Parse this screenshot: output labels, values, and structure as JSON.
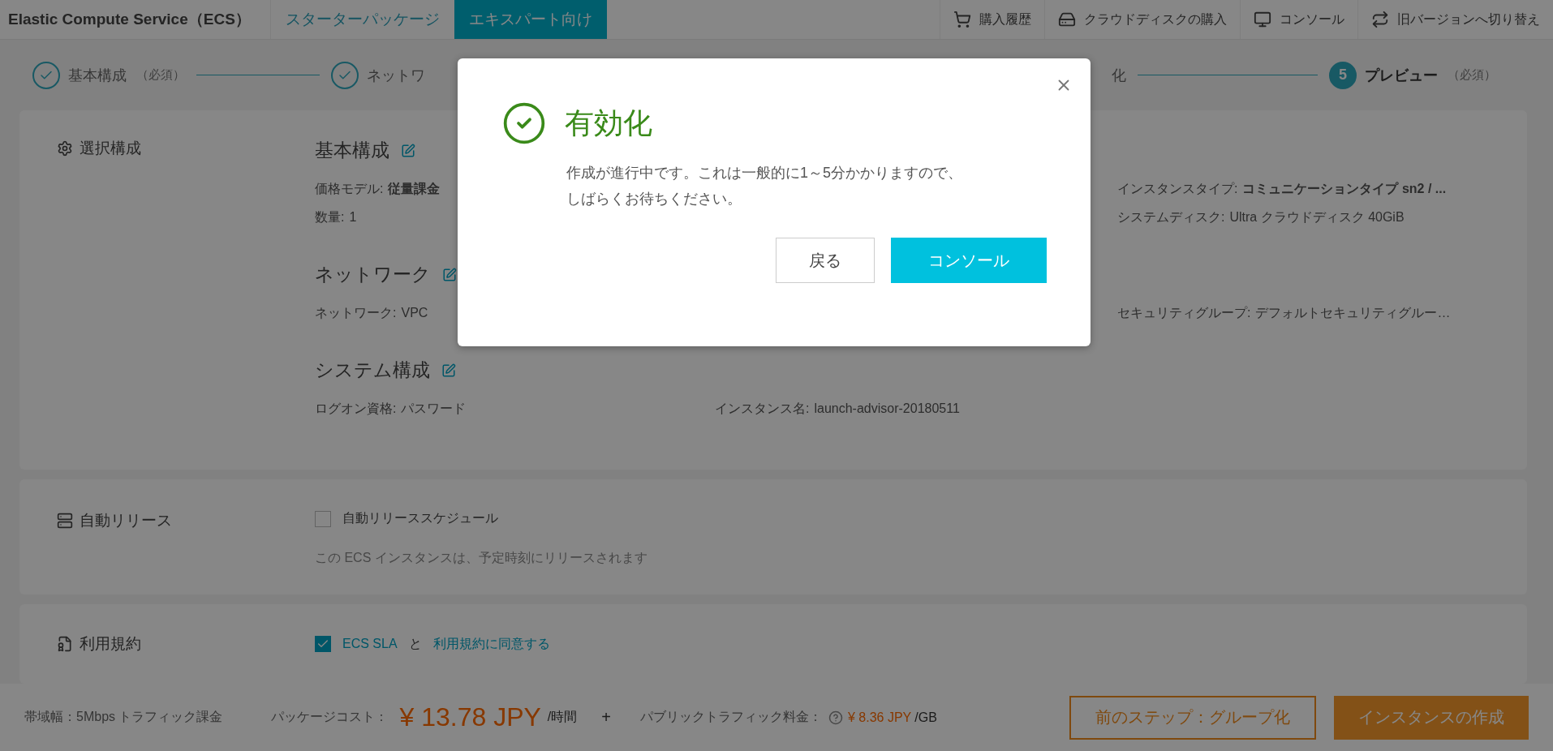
{
  "header": {
    "title": "Elastic Compute Service（ECS）",
    "tabs": [
      {
        "label": "スターターパッケージ",
        "selected": false
      },
      {
        "label": "エキスパート向け",
        "selected": true
      }
    ],
    "links": [
      "購入履歴",
      "クラウドディスクの購入",
      "コンソール",
      "旧バージョンへ切り替え"
    ]
  },
  "steps": [
    {
      "label": "基本構成",
      "note": "（必須）",
      "done": true,
      "current": false
    },
    {
      "label": "ネットワ",
      "done": true,
      "current": false
    },
    {
      "label": "化"
    },
    {
      "number": "5",
      "label": "プレビュー",
      "note": "（必須）",
      "done": false,
      "current": true
    }
  ],
  "summary": {
    "label": "選択構成",
    "sections": [
      {
        "title": "基本構成",
        "rows": [
          [
            {
              "label": "価格モデル:",
              "value": "従量課金",
              "bold": true
            },
            null,
            {
              "label": "インスタンスタイプ:",
              "value": "コミュニケーションタイプ sn2 / ...",
              "bold": true
            }
          ],
          [
            {
              "label": "数量:",
              "value": "1",
              "bold": false
            },
            null,
            {
              "label": "システムディスク:",
              "value": "Ultra クラウドディスク 40GiB",
              "bold": false
            }
          ]
        ]
      },
      {
        "title": "ネットワーク",
        "rows": [
          [
            {
              "label": "ネットワーク:",
              "value": "VPC",
              "bold": false
            },
            null,
            {
              "label": "セキュリティグループ:",
              "value": "デフォルトセキュリティグルー…",
              "bold": false
            }
          ]
        ]
      },
      {
        "title": "システム構成",
        "rows": [
          [
            {
              "label": "ログオン資格:",
              "value": "パスワード",
              "bold": false
            },
            {
              "label": "インスタンス名:",
              "value": "launch-advisor-20180511",
              "bold": false
            },
            null
          ]
        ]
      }
    ]
  },
  "auto_release": {
    "label": "自動リリース",
    "option": {
      "label": "自動リリーススケジュール",
      "checked": false
    },
    "hint": "この ECS インスタンスは、予定時刻にリリースされます"
  },
  "terms": {
    "label": "利用規約",
    "checked": true,
    "link_1": "ECS SLA",
    "joiner": "と",
    "link_2": "利用規約に同意する"
  },
  "footer": {
    "bandwidth": "帯域幅：5Mbps トラフィック課金",
    "package_label": "パッケージコスト：",
    "package_price": "¥ 13.78 JPY",
    "package_unit": "/時間",
    "plus": "+",
    "traffic_label": "パブリックトラフィック料金：",
    "traffic_price": "¥ 8.36 JPY",
    "traffic_unit": "/GB",
    "prev_button": "前のステップ：グループ化",
    "create_button": "インスタンスの作成"
  },
  "dialog": {
    "title": "有効化",
    "message_lines": [
      "作成が進行中です。これは一般的に1～5分かかりますので、",
      "しばらくお待ちください。"
    ],
    "buttons": [
      {
        "label": "戻る",
        "kind": "secondary"
      },
      {
        "label": "コンソール",
        "kind": "primary"
      }
    ]
  }
}
